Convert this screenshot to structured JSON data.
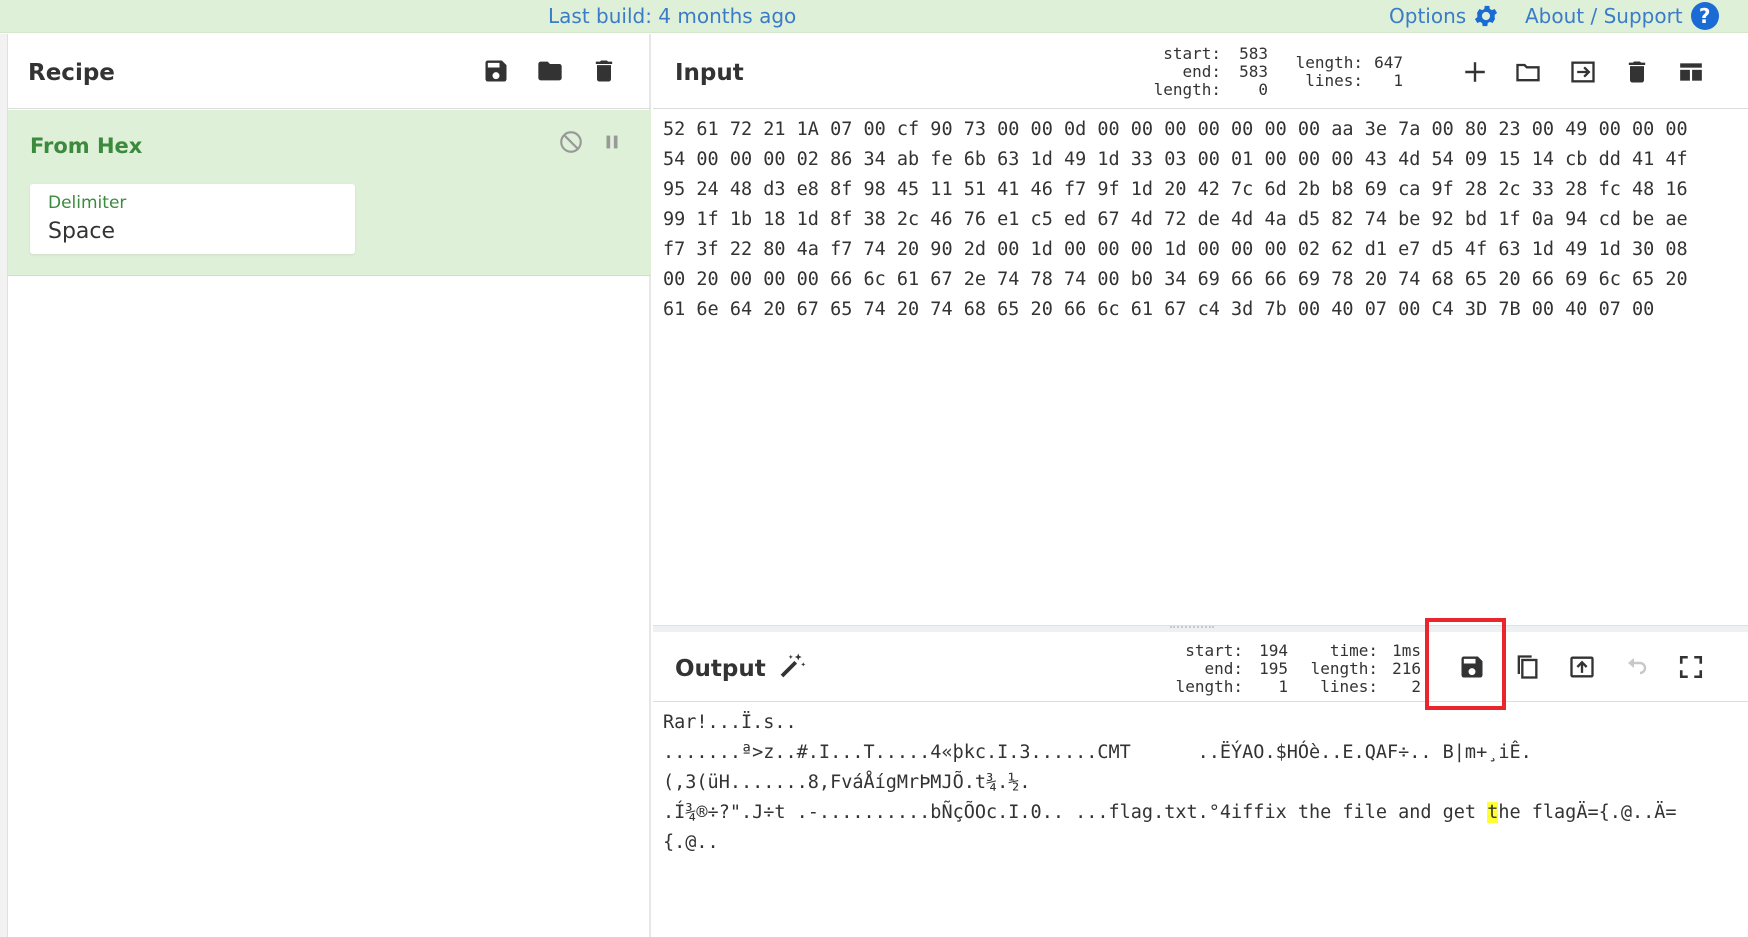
{
  "banner": {
    "build_text": "Last build: 4 months ago",
    "options_label": "Options",
    "about_label": "About / Support",
    "help_glyph": "?",
    "options_icon": "gear-icon",
    "about_icon": "help-icon",
    "bg_color": "#dff0d8",
    "link_color": "#3a7cc7"
  },
  "recipe": {
    "title": "Recipe",
    "buttons": [
      "save-icon",
      "folder-icon",
      "trash-icon"
    ],
    "operation": {
      "name": "From Hex",
      "disable_icon": "disable-icon",
      "pause_icon": "pause-icon",
      "arg_label": "Delimiter",
      "arg_value": "Space",
      "bg_color": "#dff0d8",
      "name_color": "#3c8a3e"
    }
  },
  "input": {
    "title": "Input",
    "stats": {
      "start_label": "start:",
      "start_value": "583",
      "end_label": "end:",
      "end_value": "583",
      "length_label": "length:",
      "length_value": "0",
      "total_length_label": "length:",
      "total_length_value": "647",
      "lines_label": "lines:",
      "lines_value": "1"
    },
    "buttons": [
      "add-icon",
      "folder-icon",
      "import-icon",
      "trash-icon",
      "layout-icon"
    ],
    "lines": [
      "52 61 72 21 1A 07 00 cf 90 73 00 00 0d 00 00 00 00 00 00 00 aa 3e 7a 00 80 23 00 49 00 00 00",
      "54 00 00 00 02 86 34 ab fe 6b 63 1d 49 1d 33 03 00 01 00 00 00 43 4d 54 09 15 14 cb dd 41 4f",
      "95 24 48 d3 e8 8f 98 45 11 51 41 46 f7 9f 1d 20 42 7c 6d 2b b8 69 ca 9f 28 2c 33 28 fc 48 16",
      "99 1f 1b 18 1d 8f 38 2c 46 76 e1 c5 ed 67 4d 72 de 4d 4a d5 82 74 be 92 bd 1f 0a 94 cd be ae",
      "f7 3f 22 80 4a f7 74 20 90 2d 00 1d 00 00 00 1d 00 00 00 02 62 d1 e7 d5 4f 63 1d 49 1d 30 08",
      "00 20 00 00 00 66 6c 61 67 2e 74 78 74 00 b0 34 69 66 66 69 78 20 74 68 65 20 66 69 6c 65 20",
      "61 6e 64 20 67 65 74 20 74 68 65 20 66 6c 61 67 c4 3d 7b 00 40 07 00 C4 3D 7B 00 40 07 00"
    ]
  },
  "output": {
    "title": "Output",
    "magic_icon": "magic-wand-icon",
    "stats": {
      "start_label": "start:",
      "start_value": "194",
      "end_label": "end:",
      "end_value": "195",
      "length_label": "length:",
      "length_value": "1",
      "time_label": "time:",
      "time_value": "1ms",
      "total_length_label": "length:",
      "total_length_value": "216",
      "lines_label": "lines:",
      "lines_value": "2"
    },
    "buttons": [
      "save-icon",
      "copy-icon",
      "replace-input-icon",
      "undo-icon",
      "fullscreen-icon"
    ],
    "lines": [
      "Rar!...Ï.s..",
      ".......ª>z..#.I...T.....4«þkc.I.3......CMT      ..ËÝAO.$HÓè..E.QAF÷.. B|m+¸iÊ.",
      "(,3(üH.......8,FváÅígMrÞMJÕ.t¾.½.",
      ".Í¾®÷?\".J÷t .-..........bÑçÕOc.I.0.. ...flag.txt.°4iffix the file and get ",
      "{.@.."
    ],
    "line4_highlight": "t",
    "line4_rest": "he flagÄ={.@..Ä=",
    "highlight_color": "#ffff33",
    "callout_color": "#e8262b"
  }
}
